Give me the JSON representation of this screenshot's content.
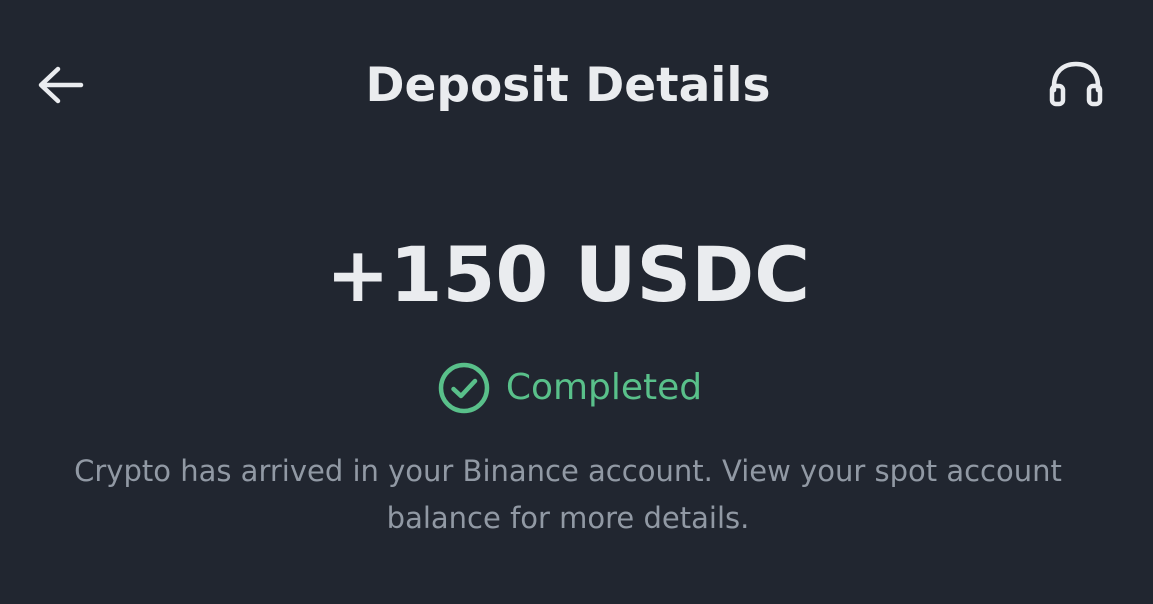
{
  "header": {
    "title": "Deposit Details",
    "back_icon": "arrow-left-icon",
    "support_icon": "headset-icon"
  },
  "deposit": {
    "amount": "+150 USDC",
    "status": "Completed",
    "status_icon": "check-circle-icon",
    "description": "Crypto has arrived in your Binance account. View your spot account balance for more details."
  },
  "colors": {
    "background": "#212630",
    "primary_text": "#EAECEF",
    "success": "#59C08A",
    "secondary_text": "#9199A4"
  }
}
